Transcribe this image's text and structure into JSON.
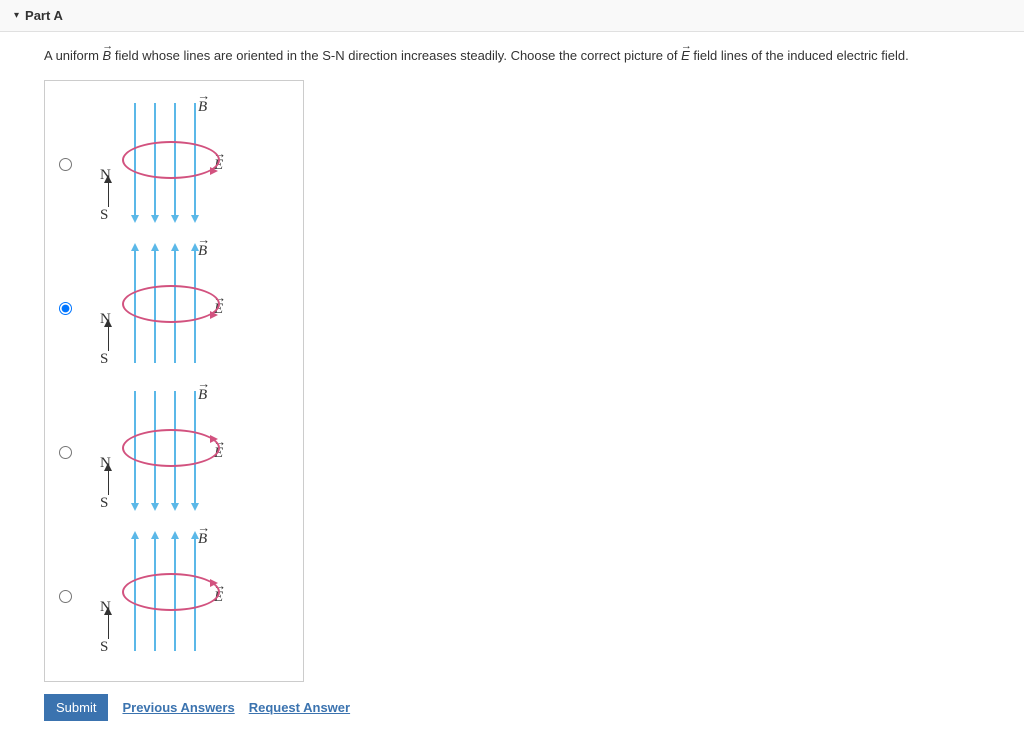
{
  "header": {
    "title": "Part A"
  },
  "question": {
    "pre": "A uniform ",
    "b_sym": "B",
    "mid": " field whose lines are oriented in the S-N direction increases steadily. Choose the correct picture of ",
    "e_sym": "E",
    "post": " field lines of the induced electric field."
  },
  "labels": {
    "B": "B",
    "E": "E",
    "N": "N",
    "S": "S"
  },
  "options": [
    {
      "id": "opt1",
      "checked": false,
      "b_direction": "down",
      "e_direction": "cw"
    },
    {
      "id": "opt2",
      "checked": true,
      "b_direction": "up",
      "e_direction": "cw"
    },
    {
      "id": "opt3",
      "checked": false,
      "b_direction": "down",
      "e_direction": "ccw"
    },
    {
      "id": "opt4",
      "checked": false,
      "b_direction": "up",
      "e_direction": "ccw"
    }
  ],
  "actions": {
    "submit": "Submit",
    "prev": "Previous Answers",
    "request": "Request Answer"
  }
}
